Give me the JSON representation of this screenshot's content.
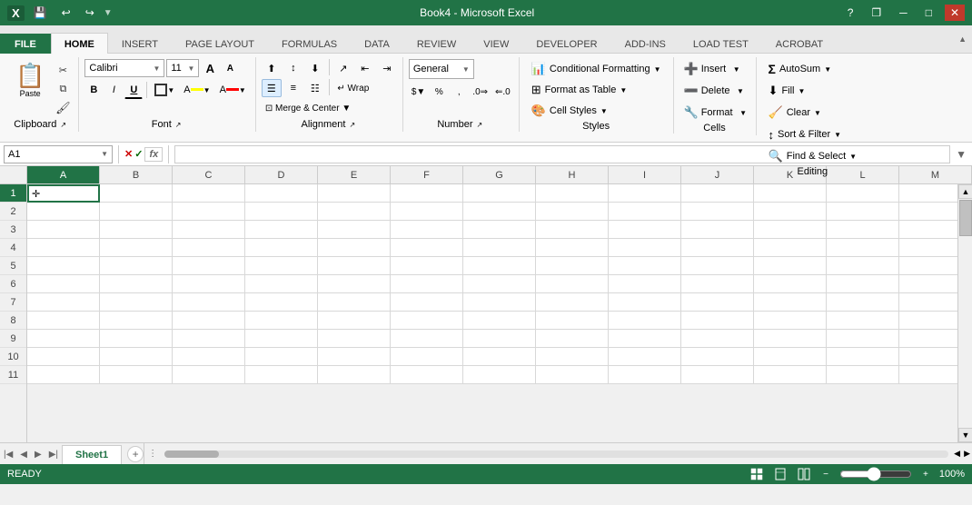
{
  "titlebar": {
    "title": "Book4 - Microsoft Excel",
    "help_btn": "?",
    "restore_btn": "❐",
    "min_btn": "─",
    "max_btn": "□",
    "close_btn": "✕",
    "excel_icon": "X"
  },
  "ribbon": {
    "tabs": [
      {
        "id": "file",
        "label": "FILE"
      },
      {
        "id": "home",
        "label": "HOME",
        "active": true
      },
      {
        "id": "insert",
        "label": "INSERT"
      },
      {
        "id": "page_layout",
        "label": "PAGE LAYOUT"
      },
      {
        "id": "formulas",
        "label": "FORMULAS"
      },
      {
        "id": "data",
        "label": "DATA"
      },
      {
        "id": "review",
        "label": "REVIEW"
      },
      {
        "id": "view",
        "label": "VIEW"
      },
      {
        "id": "developer",
        "label": "DEVELOPER"
      },
      {
        "id": "add_ins",
        "label": "ADD-INS"
      },
      {
        "id": "load_test",
        "label": "LOAD TEST"
      },
      {
        "id": "acrobat",
        "label": "ACROBAT"
      }
    ],
    "groups": {
      "clipboard": {
        "label": "Clipboard",
        "paste_label": "Paste",
        "copy_label": "Copy",
        "cut_label": "Cut",
        "format_painter_label": "Format Painter"
      },
      "font": {
        "label": "Font",
        "font_name": "Calibri",
        "font_size": "11",
        "bold": "B",
        "italic": "I",
        "underline": "U",
        "increase_size": "A",
        "decrease_size": "A",
        "border_label": "Border",
        "fill_label": "Fill Color",
        "font_color_label": "Font Color"
      },
      "alignment": {
        "label": "Alignment",
        "wrap_label": "Wrap Text",
        "merge_label": "Merge & Center"
      },
      "number": {
        "label": "Number",
        "format": "General",
        "percent": "%",
        "comma": ",",
        "dollar": "$",
        "increase_dec": ".0",
        "decrease_dec": ".00"
      },
      "styles": {
        "label": "Styles",
        "conditional_formatting": "Conditional Formatting",
        "format_as_table": "Format as Table",
        "cell_styles": "Cell Styles"
      },
      "cells": {
        "label": "Cells",
        "insert": "Insert",
        "delete": "Delete",
        "format": "Format"
      },
      "editing": {
        "label": "Editing",
        "autosum": "Σ",
        "fill": "Fill",
        "clear": "Clear",
        "sort_filter": "Sort & Filter",
        "find_select": "Find & Select"
      }
    }
  },
  "formula_bar": {
    "cell_ref": "A1",
    "formula_value": "",
    "cancel_label": "✕",
    "confirm_label": "✓",
    "formula_label": "fx",
    "expand_label": "▼"
  },
  "spreadsheet": {
    "columns": [
      "A",
      "B",
      "C",
      "D",
      "E",
      "F",
      "G",
      "H",
      "I",
      "J",
      "K",
      "L",
      "M"
    ],
    "rows": [
      "1",
      "2",
      "3",
      "4",
      "5",
      "6",
      "7",
      "8",
      "9",
      "10",
      "11"
    ],
    "selected_cell": "A1",
    "cell_content": "✛"
  },
  "sheet_tabs": {
    "active_tab": "Sheet1",
    "tabs": [
      "Sheet1"
    ],
    "add_label": "+"
  },
  "status_bar": {
    "ready_label": "READY",
    "zoom_label": "100%"
  }
}
